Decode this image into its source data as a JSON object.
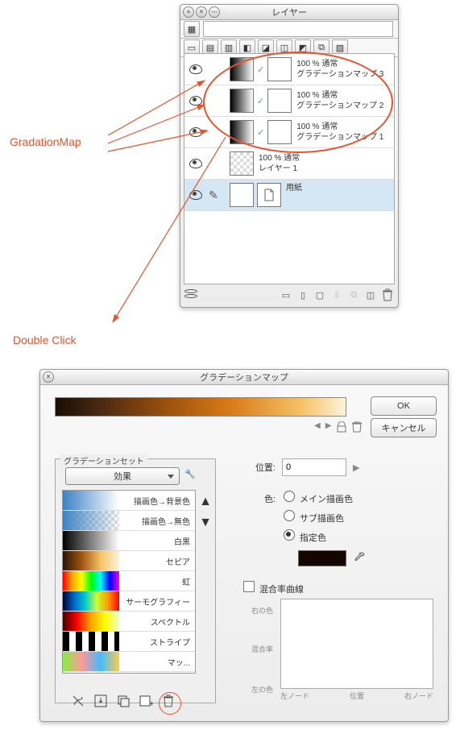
{
  "annotations": {
    "gradmap": "GradationMap",
    "doubleclick": "Double Click"
  },
  "layerPanel": {
    "title": "レイヤー",
    "layers": [
      {
        "opacity": "100 % 通常",
        "name": "グラデーションマップ 3"
      },
      {
        "opacity": "100 % 通常",
        "name": "グラデーションマップ 2"
      },
      {
        "opacity": "100 % 通常",
        "name": "グラデーションマップ 1"
      },
      {
        "opacity": "100 % 通常",
        "name": "レイヤー 1"
      },
      {
        "opacity": "",
        "name": "用紙"
      }
    ]
  },
  "dialog": {
    "title": "グラデーションマップ",
    "ok": "OK",
    "cancel": "キャンセル",
    "gradientSet": {
      "legend": "グラデーションセット",
      "combo": "効果",
      "presets": [
        {
          "name": "描画色→背景色"
        },
        {
          "name": "描画色→無色"
        },
        {
          "name": "白黒"
        },
        {
          "name": "セピア"
        },
        {
          "name": "虹"
        },
        {
          "name": "サーモグラフィー"
        },
        {
          "name": "スペクトル"
        },
        {
          "name": "ストライプ"
        },
        {
          "name": "マッ..."
        }
      ]
    },
    "position": {
      "label": "位置:",
      "value": "0"
    },
    "color": {
      "label": "色:",
      "main": "メイン描画色",
      "sub": "サブ描画色",
      "spec": "指定色"
    },
    "curve": {
      "check": "混合率曲線",
      "rightColor": "右の色",
      "mix": "混合率",
      "leftColor": "左の色",
      "leftNode": "左ノード",
      "pos": "位置",
      "rightNode": "右ノード"
    }
  }
}
